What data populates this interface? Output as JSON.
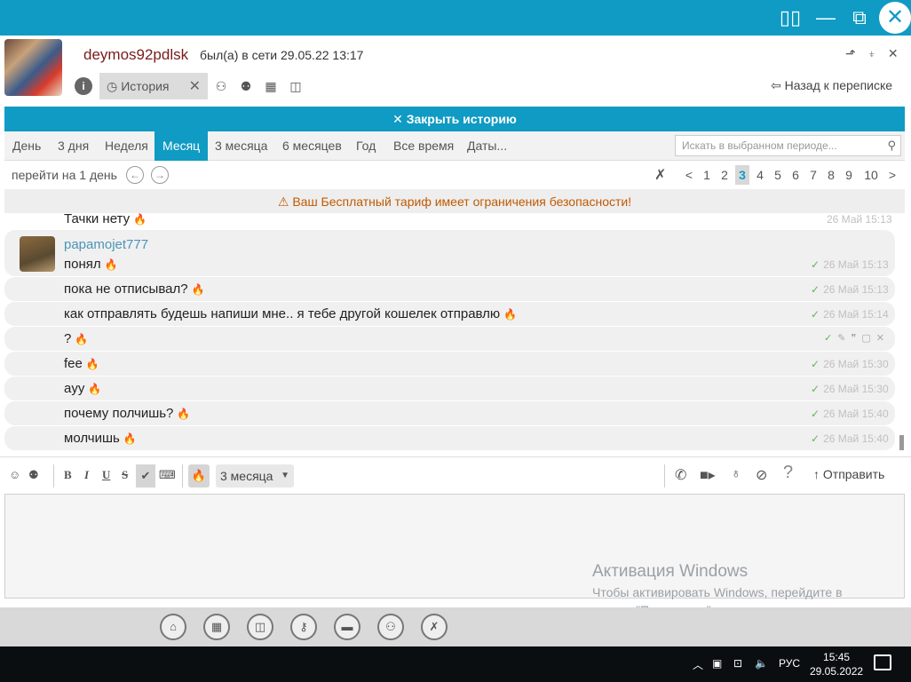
{
  "window": {
    "buttons": [
      "▯▯",
      "—",
      "⧉"
    ],
    "close": "✕"
  },
  "contact": {
    "name": "deymos92pdlsk",
    "status": "был(а) в сети 29.05.22 13:17"
  },
  "header_icons": [
    "pin-icon",
    "minimize-to-tray-icon",
    "close-icon"
  ],
  "history_tab": {
    "label": "История",
    "close": "✕"
  },
  "back_to_chat": "Назад к переписке",
  "close_history": "✕ Закрыть историю",
  "periods": [
    "День",
    "3 дня",
    "Неделя",
    "Месяц",
    "3 месяца",
    "6 месяцев",
    "Год",
    "Все время",
    "Даты..."
  ],
  "active_period": "Месяц",
  "search": {
    "placeholder": "Искать в выбранном периоде..."
  },
  "goto_day": "перейти на 1 день",
  "pager": {
    "prev": "<",
    "next": ">",
    "pages": [
      "1",
      "2",
      "3",
      "4",
      "5",
      "6",
      "7",
      "8",
      "9",
      "10"
    ],
    "current": "3"
  },
  "warning": "⚠ Ваш Бесплатный тариф имеет ограничения безопасности!",
  "messages": {
    "prev_tail": {
      "text": "Тачки нету",
      "time": "26 Май 15:13"
    },
    "sender": "papamojet777",
    "items": [
      {
        "text": "понял",
        "time": "26 Май 15:13"
      },
      {
        "text": "пока не отписывал?",
        "time": "26 Май 15:13"
      },
      {
        "text": "как отправлять будешь напиши мне.. я тебе другой кошелек отправлю",
        "time": "26 Май 15:14"
      },
      {
        "text": "?",
        "time": ""
      },
      {
        "text": "fee",
        "time": "26 Май 15:30"
      },
      {
        "text": "ayy",
        "time": "26 Май 15:30"
      },
      {
        "text": "почему полчишь?",
        "time": "26 Май 15:40"
      },
      {
        "text": "молчишь",
        "time": "26 Май 15:40"
      }
    ]
  },
  "format": {
    "bold": "B",
    "italic": "I",
    "underline": "U",
    "strike": "S"
  },
  "burn_period": "3 месяца",
  "send_label": "↑ Отправить",
  "activation": {
    "title": "Активация Windows",
    "text": "Чтобы активировать Windows, перейдите в раздел \"Параметры\"."
  },
  "dock_icons": [
    "home-icon",
    "calendar-icon",
    "files-icon",
    "key-icon",
    "folder-icon",
    "contacts-icon",
    "tools-icon"
  ],
  "taskbar": {
    "lang": "РУС",
    "time": "15:45",
    "date": "29.05.2022"
  }
}
